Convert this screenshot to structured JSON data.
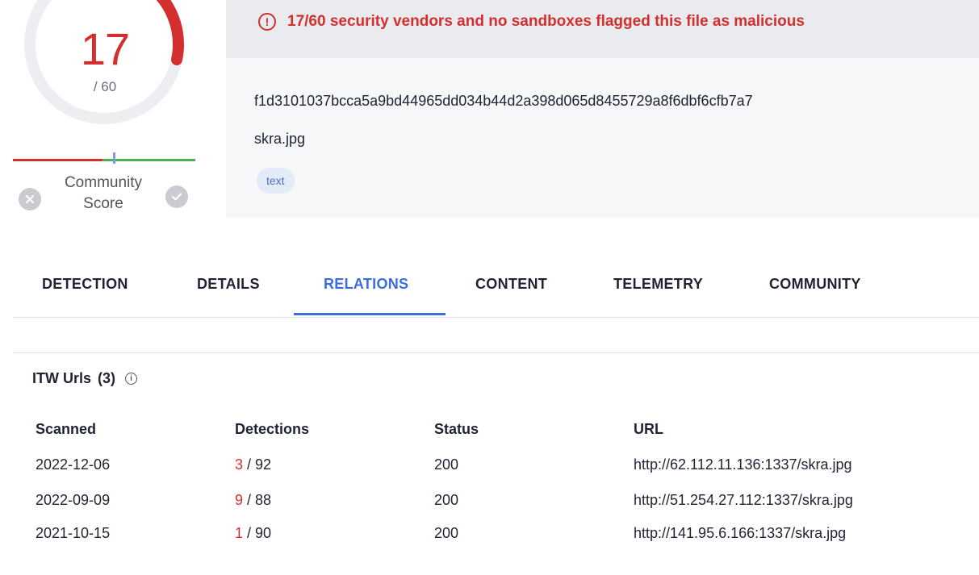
{
  "score": {
    "detections": "17",
    "total": "/ 60",
    "malicious_fraction": 0.283,
    "community_label": "Community\nScore",
    "community_score_fraction": 0.55
  },
  "alert": {
    "icon": "exclamation-circle-icon",
    "text": "17/60 security vendors and no sandboxes flagged this file as malicious"
  },
  "file": {
    "hash": "f1d3101037bcca5a9bd44965dd034b44d2a398d065d8455729a8f6dbf6cfb7a7",
    "name": "skra.jpg",
    "tags": [
      "text"
    ]
  },
  "tabs": [
    {
      "label": "DETECTION"
    },
    {
      "label": "DETAILS"
    },
    {
      "label": "RELATIONS"
    },
    {
      "label": "CONTENT"
    },
    {
      "label": "TELEMETRY"
    },
    {
      "label": "COMMUNITY"
    }
  ],
  "active_tab": "RELATIONS",
  "itw": {
    "title": "ITW Urls",
    "count": "(3)",
    "columns": [
      "Scanned",
      "Detections",
      "Status",
      "URL"
    ],
    "rows": [
      {
        "scanned": "2022-12-06",
        "det": "3",
        "det_total": " / 92",
        "status": "200",
        "url": "http://62.112.11.136:1337/skra.jpg"
      },
      {
        "scanned": "2022-09-09",
        "det": "9",
        "det_total": " / 88",
        "status": "200",
        "url": "http://51.254.27.112:1337/skra.jpg"
      },
      {
        "scanned": "2021-10-15",
        "det": "1",
        "det_total": " / 90",
        "status": "200",
        "url": "http://141.95.6.166:1337/skra.jpg"
      }
    ]
  },
  "colors": {
    "malicious": "#d32f2f",
    "accent": "#3b6de0",
    "harmless": "#4caf50"
  }
}
